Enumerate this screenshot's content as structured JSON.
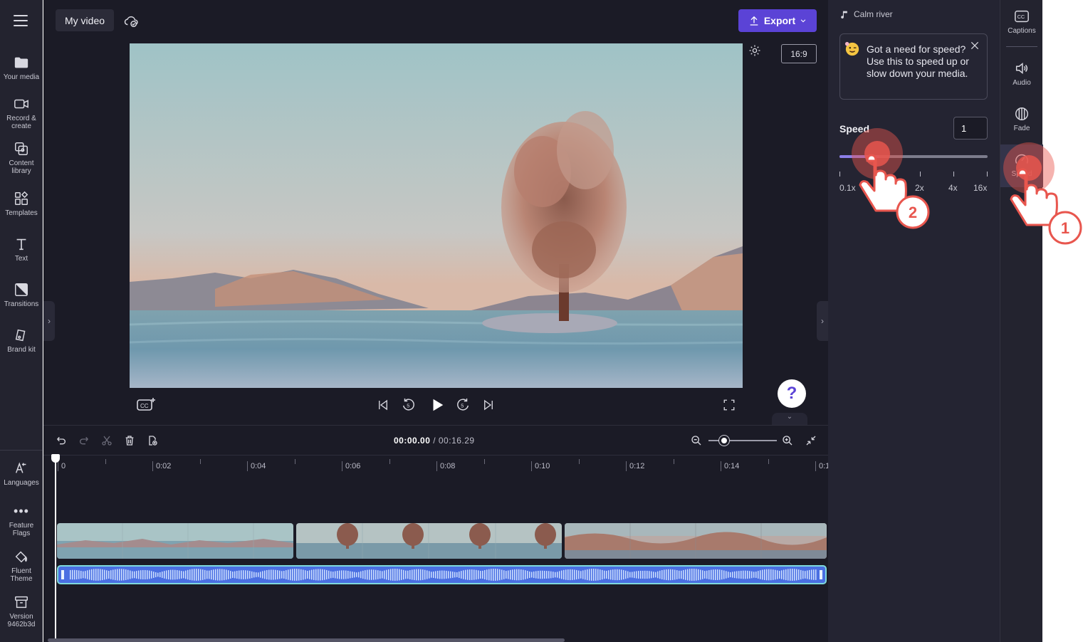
{
  "nav": {
    "items": [
      {
        "label": "Your media",
        "icon": "folder-icon"
      },
      {
        "label": "Record & create",
        "icon": "camera-icon"
      },
      {
        "label": "Content library",
        "icon": "library-icon"
      },
      {
        "label": "Templates",
        "icon": "templates-icon"
      },
      {
        "label": "Text",
        "icon": "text-icon"
      },
      {
        "label": "Transitions",
        "icon": "transitions-icon"
      },
      {
        "label": "Brand kit",
        "icon": "brand-kit-icon"
      }
    ],
    "bottom": [
      {
        "label": "Languages",
        "icon": "languages-icon"
      },
      {
        "label": "Feature Flags",
        "icon": "more-icon"
      },
      {
        "label": "Fluent Theme",
        "icon": "paint-bucket-icon"
      },
      {
        "label": "Version 9462b3d",
        "icon": "archive-icon"
      }
    ]
  },
  "header": {
    "title": "My video",
    "export_label": "Export"
  },
  "player": {
    "aspect_ratio": "16:9",
    "help_label": "?"
  },
  "timeline": {
    "current_time": "00:00.00",
    "total_time": "/ 00:16.29",
    "ticks": [
      "0",
      "0:02",
      "0:04",
      "0:06",
      "0:08",
      "0:10",
      "0:12",
      "0:14",
      "0:1"
    ],
    "zoom_level": 0.22
  },
  "properties": {
    "track_name": "Calm river",
    "tip": "Got a need for speed? Use this to speed up or slow down your media.",
    "speed_label": "Speed",
    "speed_value": "1",
    "speed_fill": 0.27,
    "speed_marks": [
      "0.1x",
      "2x",
      "4x",
      "16x"
    ]
  },
  "right_tabs": [
    {
      "label": "Captions",
      "icon": "captions-icon"
    },
    {
      "label": "Audio",
      "icon": "speaker-icon"
    },
    {
      "label": "Fade",
      "icon": "fade-icon"
    },
    {
      "label": "Speed",
      "icon": "speedometer-icon"
    }
  ],
  "annotations": {
    "step1": "1",
    "step2": "2"
  },
  "colors": {
    "accent": "#5b43d6",
    "panel": "#242432",
    "audio_track": "#4a6fe2",
    "hand_highlight": "#e8564e"
  }
}
